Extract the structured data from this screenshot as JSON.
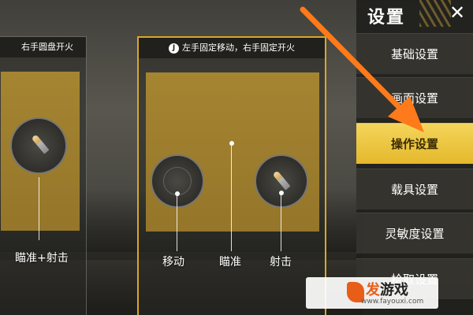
{
  "panel": {
    "title": "设置",
    "close_glyph": "✕",
    "menu": [
      {
        "label": "基础设置",
        "active": false
      },
      {
        "label": "画面设置",
        "active": false
      },
      {
        "label": "操作设置",
        "active": true
      },
      {
        "label": "载具设置",
        "active": false
      },
      {
        "label": "灵敏度设置",
        "active": false
      },
      {
        "label": "拾取设置",
        "active": false
      }
    ]
  },
  "cards": {
    "left": {
      "header": "右手圆盘开火",
      "controls": [
        "瞄准+射击"
      ]
    },
    "middle": {
      "header_icon": "J",
      "header": "左手固定移动，右手固定开火",
      "controls": [
        "移动",
        "瞄准",
        "射击"
      ]
    }
  },
  "watermark": {
    "name_prefix": "发",
    "name_rest": "游戏",
    "url": "www.fayouxi.com"
  },
  "colors": {
    "accent": "#e4b82c",
    "arrow": "#ff7a1a",
    "preview_bg": "#a58531"
  },
  "icons": {
    "close": "close-icon",
    "fire_button": "bullet-icon",
    "move_joystick": "joystick-icon"
  }
}
